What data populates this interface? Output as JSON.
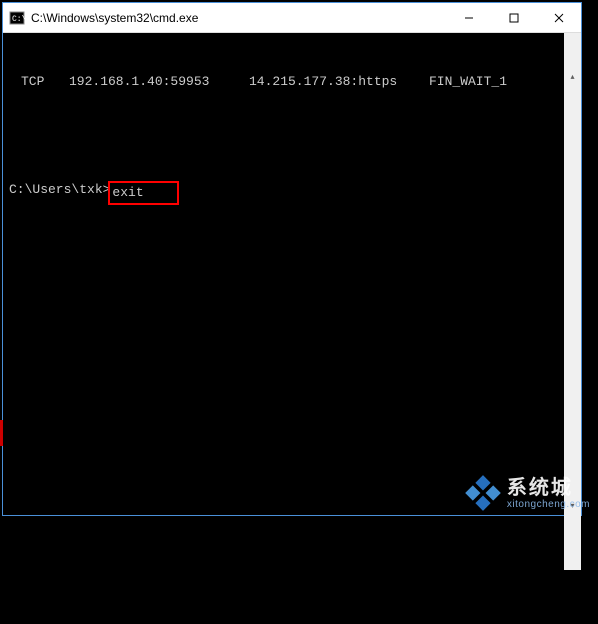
{
  "window": {
    "title": "C:\\Windows\\system32\\cmd.exe"
  },
  "terminal": {
    "line1": {
      "protocol": "TCP",
      "local": "192.168.1.40:59953",
      "remote": "14.215.177.38:https",
      "state": "FIN_WAIT_1"
    },
    "prompt": "C:\\Users\\txk>",
    "command": "exit"
  },
  "watermark": {
    "title": "系统城",
    "subtitle": "xitongcheng.com"
  }
}
